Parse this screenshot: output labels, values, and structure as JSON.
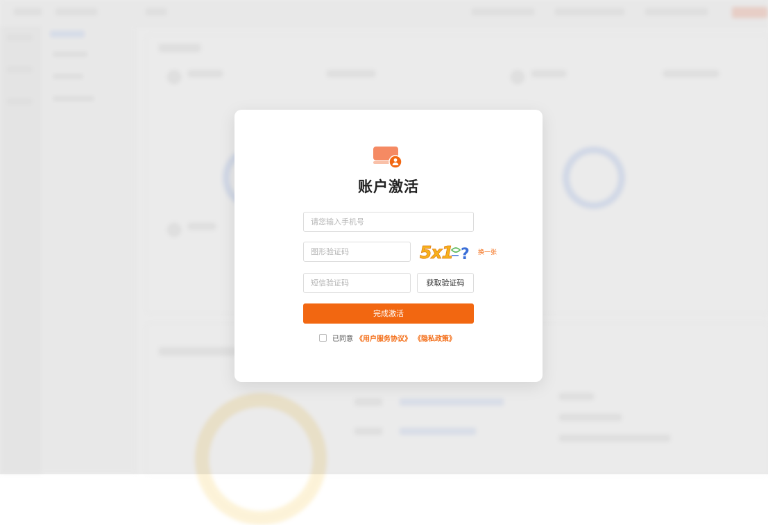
{
  "modal": {
    "title": "账户激活",
    "phone_placeholder": "请您输入手机号",
    "captcha_placeholder": "图形验证码",
    "captcha_image_text": "5x1",
    "refresh_label": "换一张",
    "sms_placeholder": "短信验证码",
    "sms_button_label": "获取验证码",
    "submit_label": "完成激活",
    "agree_prefix": "已同意",
    "terms_link": "《用户服务协议》",
    "privacy_link": "《隐私政策》"
  },
  "colors": {
    "accent": "#f26711",
    "link": "#f36c15"
  }
}
